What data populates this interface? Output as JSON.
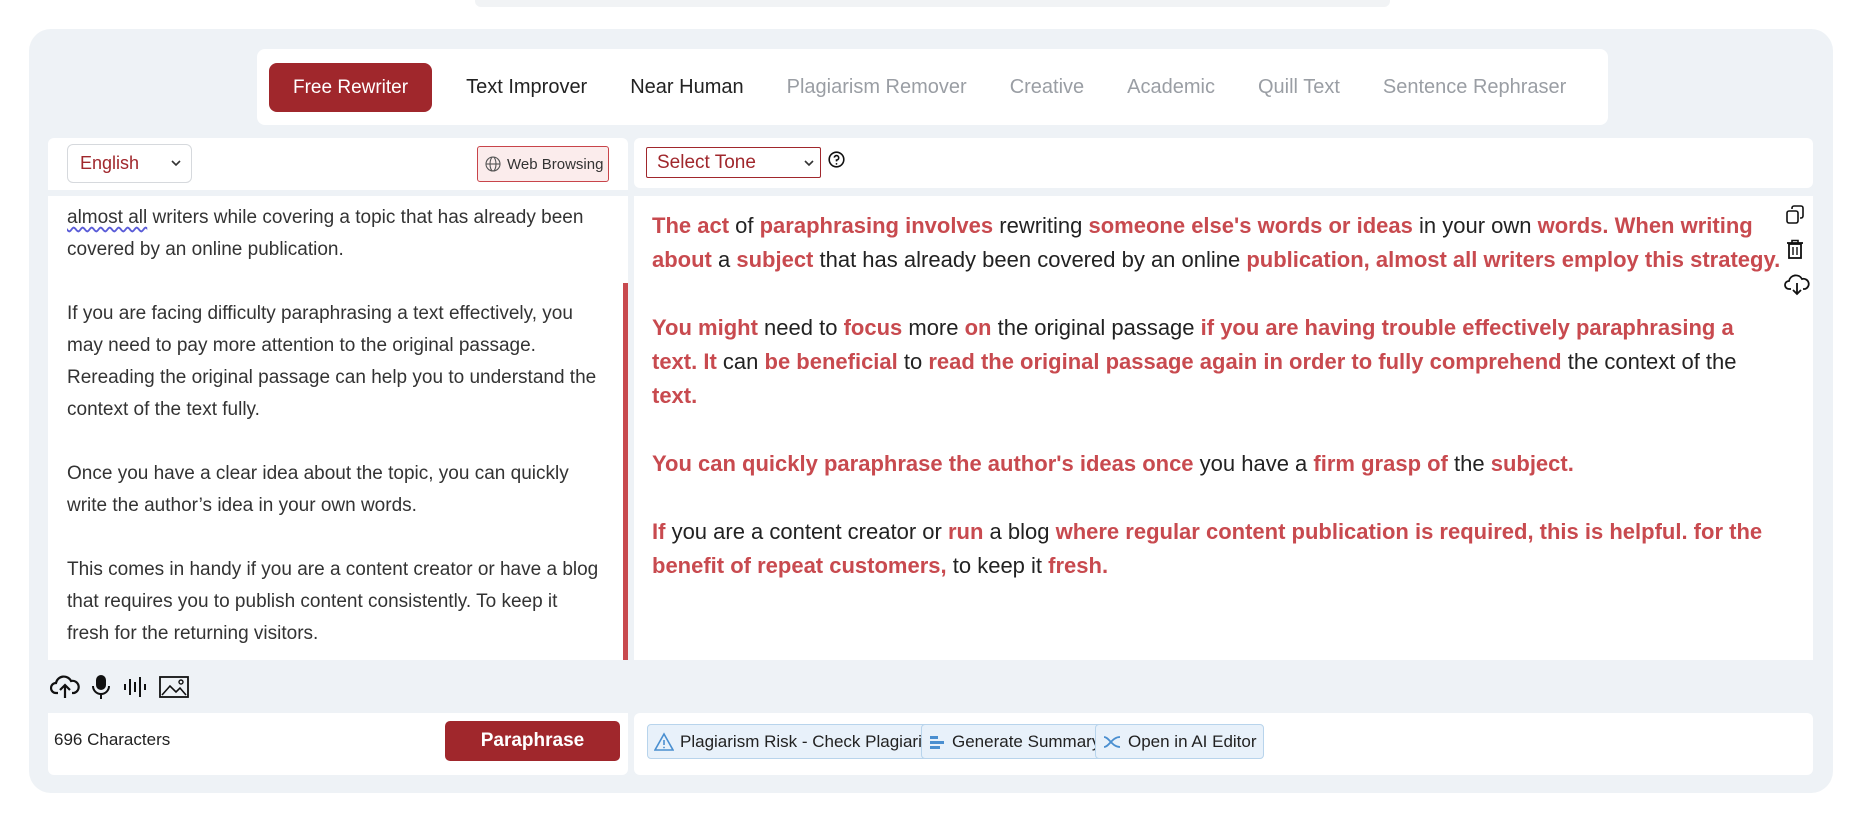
{
  "modes": [
    {
      "label": "Free Rewriter",
      "state": "active"
    },
    {
      "label": "Text Improver",
      "state": "normal"
    },
    {
      "label": "Near Human",
      "state": "normal"
    },
    {
      "label": "Plagiarism Remover",
      "state": "muted"
    },
    {
      "label": "Creative",
      "state": "muted"
    },
    {
      "label": "Academic",
      "state": "muted"
    },
    {
      "label": "Quill Text",
      "state": "muted"
    },
    {
      "label": "Sentence Rephraser",
      "state": "muted"
    }
  ],
  "input": {
    "language": "English",
    "web_browsing_label": "Web Browsing",
    "para1_squiggle": "almost all",
    "para1_rest": " writers while covering a topic that has already been covered by an online publication.",
    "para2": "If you are facing difficulty paraphrasing a text effectively, you may need to pay more attention to the original passage. Rereading the original passage can help you to understand the context of the text fully.",
    "para3": "Once you have a clear idea about the topic, you can quickly write the author’s idea in your own words.",
    "para4": "This comes in handy if you are a content creator or have a blog that requires you to publish content consistently. To keep it fresh for the returning visitors.",
    "char_count": "696 Characters",
    "paraphrase_label": "Paraphrase"
  },
  "output": {
    "tone_placeholder": "Select Tone",
    "paragraphs": [
      [
        {
          "t": "The act",
          "h": true
        },
        {
          "t": " of ",
          "h": false
        },
        {
          "t": "paraphrasing involves",
          "h": true
        },
        {
          "t": " rewriting ",
          "h": false
        },
        {
          "t": "someone else's words or ideas",
          "h": true
        },
        {
          "t": " in your own ",
          "h": false
        },
        {
          "t": "words. When writing about",
          "h": true
        },
        {
          "t": " a ",
          "h": false
        },
        {
          "t": "subject",
          "h": true
        },
        {
          "t": " that has already been covered by an online ",
          "h": false
        },
        {
          "t": "publication, almost all writers employ this strategy.",
          "h": true
        }
      ],
      [
        {
          "t": "You might",
          "h": true
        },
        {
          "t": " need to ",
          "h": false
        },
        {
          "t": "focus",
          "h": true
        },
        {
          "t": " more ",
          "h": false
        },
        {
          "t": "on",
          "h": true
        },
        {
          "t": " the original passage ",
          "h": false
        },
        {
          "t": "if you are having trouble effectively paraphrasing a text. It",
          "h": true
        },
        {
          "t": " can ",
          "h": false
        },
        {
          "t": "be beneficial",
          "h": true
        },
        {
          "t": " to ",
          "h": false
        },
        {
          "t": "read the original passage again in order to fully comprehend",
          "h": true
        },
        {
          "t": " the context of the ",
          "h": false
        },
        {
          "t": "text.",
          "h": true
        }
      ],
      [
        {
          "t": "You can quickly paraphrase the author's ideas once",
          "h": true
        },
        {
          "t": " you have a ",
          "h": false
        },
        {
          "t": "firm grasp of",
          "h": true
        },
        {
          "t": " the ",
          "h": false
        },
        {
          "t": "subject.",
          "h": true
        }
      ],
      [
        {
          "t": "If",
          "h": true
        },
        {
          "t": " you are a content creator or ",
          "h": false
        },
        {
          "t": "run",
          "h": true
        },
        {
          "t": " a blog ",
          "h": false
        },
        {
          "t": "where regular content publication is required, this is helpful. for the benefit of repeat customers,",
          "h": true
        },
        {
          "t": " to keep it ",
          "h": false
        },
        {
          "t": "fresh.",
          "h": true
        }
      ]
    ],
    "actions": {
      "plagiarism": "Plagiarism Risk - Check Plagiarism",
      "summary": "Generate Summary",
      "ai_editor": "Open in AI Editor"
    }
  },
  "colors": {
    "brand": "#a0272c",
    "highlight": "#c84a4f",
    "frame_bg": "#eef2f6"
  },
  "icons": {
    "tools": [
      "upload-cloud-icon",
      "microphone-icon",
      "audio-wave-icon",
      "image-icon"
    ],
    "side": [
      "copy-icon",
      "trash-icon",
      "download-icon"
    ]
  }
}
